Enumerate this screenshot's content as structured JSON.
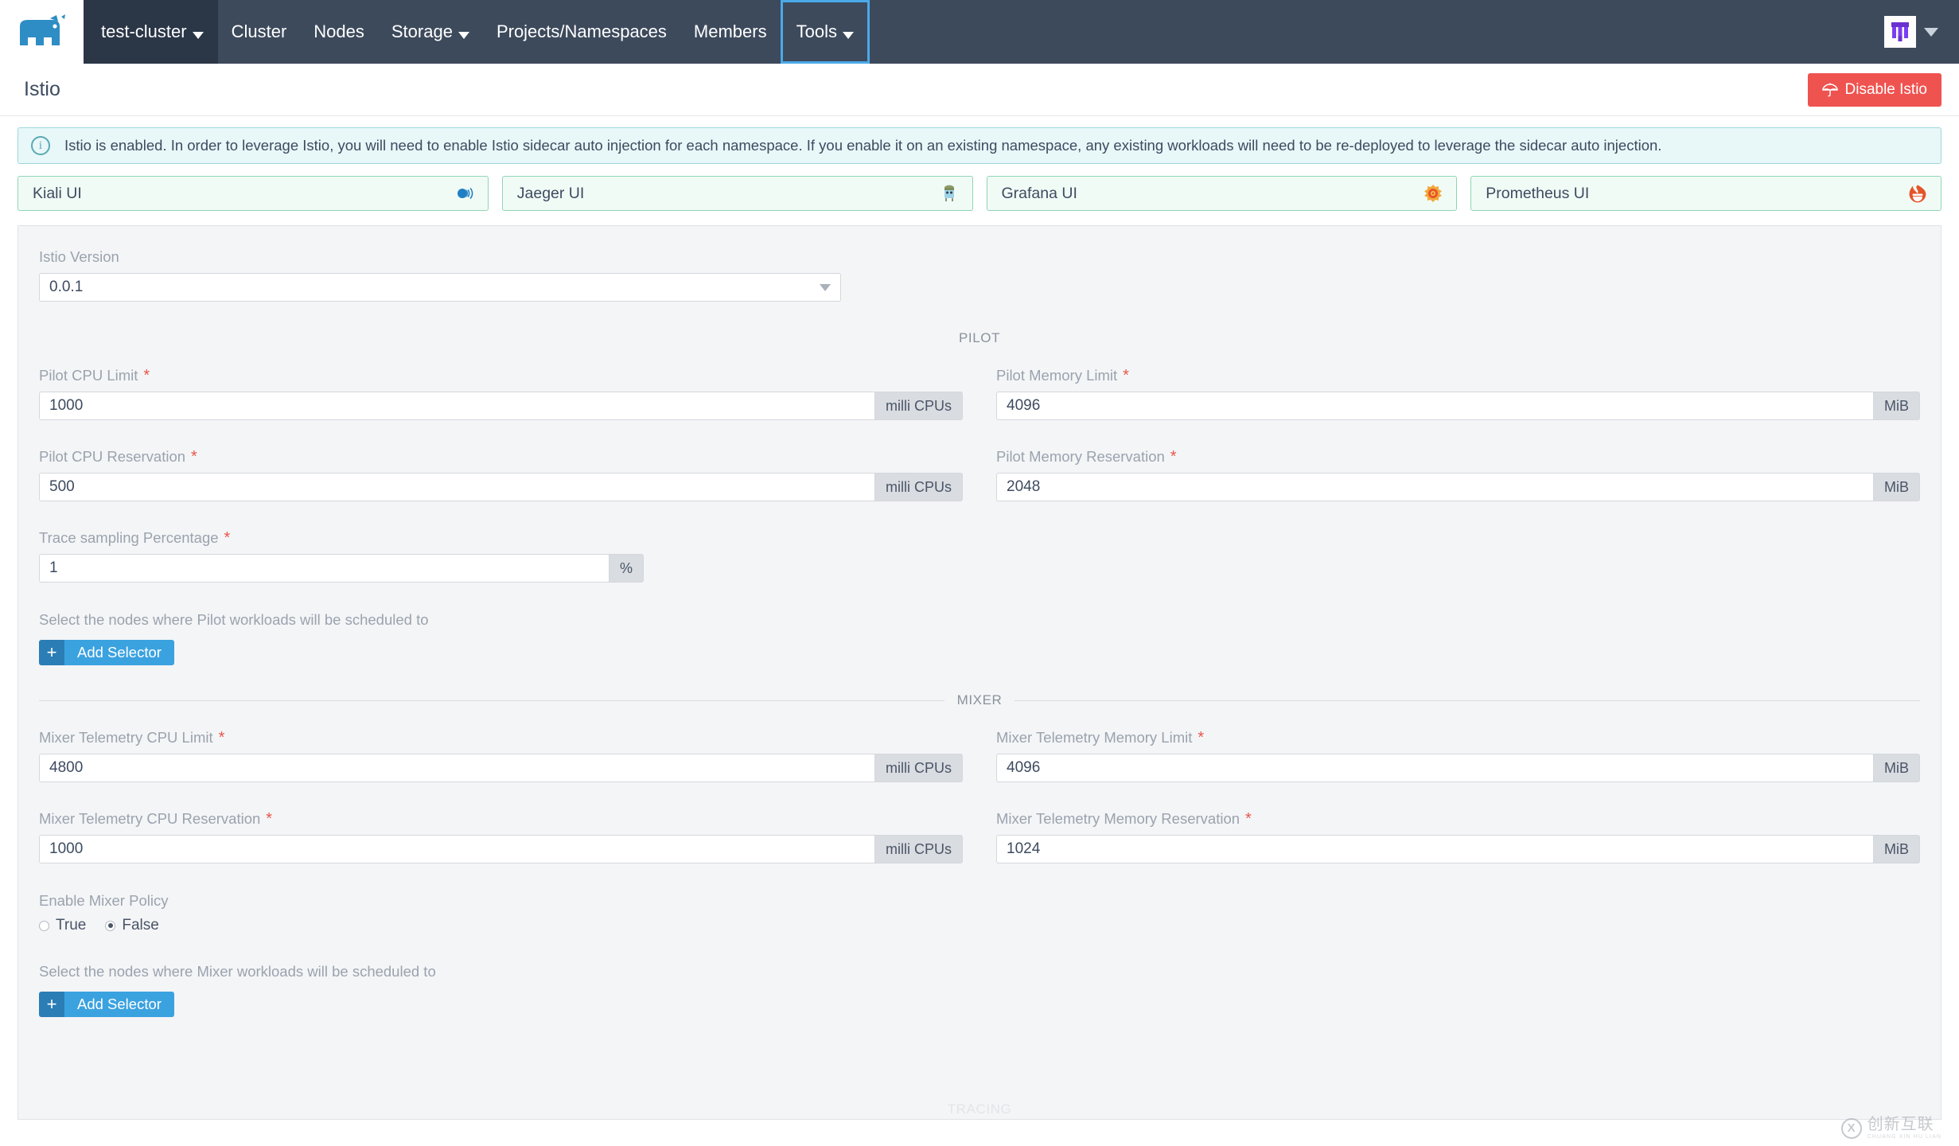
{
  "navbar": {
    "logo_icon": "rancher-cow-logo",
    "cluster_selector": {
      "label": "test-cluster",
      "icon": "chevron-down-icon"
    },
    "items": [
      {
        "label": "Cluster",
        "name": "nav-item-cluster",
        "has_caret": false,
        "focused": false
      },
      {
        "label": "Nodes",
        "name": "nav-item-nodes",
        "has_caret": false,
        "focused": false
      },
      {
        "label": "Storage",
        "name": "nav-item-storage",
        "has_caret": true,
        "focused": false
      },
      {
        "label": "Projects/Namespaces",
        "name": "nav-item-projects-namespaces",
        "has_caret": false,
        "focused": false
      },
      {
        "label": "Members",
        "name": "nav-item-members",
        "has_caret": false,
        "focused": false
      },
      {
        "label": "Tools",
        "name": "nav-item-tools",
        "has_caret": true,
        "focused": true
      }
    ],
    "user_menu": {
      "avatar_icon": "user-avatar-purple",
      "chevron_icon": "chevron-down-icon"
    },
    "background": "#3d4a5c",
    "active_background": "#2b3647",
    "focus_outline": "#4ba9e8"
  },
  "titlebar": {
    "title": "Istio",
    "disable_button": {
      "label": "Disable Istio",
      "icon": "umbrella-icon",
      "color": "#ef5350"
    }
  },
  "banner": {
    "icon": "info-circle-icon",
    "text": "Istio is enabled. In order to leverage Istio, you will need to enable Istio sidecar auto injection for each namespace. If you enable it on an existing namespace, any existing workloads will need to be re-deployed to leverage the sidecar auto injection.",
    "background": "#e8f7f8",
    "border": "#9fd7db"
  },
  "ui_cards": [
    {
      "label": "Kiali UI",
      "icon": "kiali-logo-icon",
      "name": "card-kiali-ui"
    },
    {
      "label": "Jaeger UI",
      "icon": "jaeger-logo-icon",
      "name": "card-jaeger-ui"
    },
    {
      "label": "Grafana UI",
      "icon": "grafana-logo-icon",
      "name": "card-grafana-ui"
    },
    {
      "label": "Prometheus UI",
      "icon": "prometheus-logo-icon",
      "name": "card-prometheus-ui"
    }
  ],
  "form": {
    "version": {
      "label": "Istio Version",
      "value": "0.0.1",
      "chevron_icon": "chevron-down-icon"
    },
    "pilot": {
      "section_label": "PILOT",
      "cpu_limit": {
        "label": "Pilot CPU Limit",
        "required": "*",
        "value": "1000",
        "unit": "milli CPUs"
      },
      "memory_limit": {
        "label": "Pilot Memory Limit",
        "required": "*",
        "value": "4096",
        "unit": "MiB"
      },
      "cpu_reservation": {
        "label": "Pilot CPU Reservation",
        "required": "*",
        "value": "500",
        "unit": "milli CPUs"
      },
      "memory_reservation": {
        "label": "Pilot Memory Reservation",
        "required": "*",
        "value": "2048",
        "unit": "MiB"
      },
      "trace_sampling": {
        "label": "Trace sampling Percentage",
        "required": "*",
        "value": "1",
        "unit": "%"
      },
      "node_selector_hint": "Select the nodes where Pilot workloads will be scheduled to",
      "add_selector": {
        "label": "Add Selector",
        "plus_icon": "plus-icon"
      }
    },
    "mixer": {
      "section_label": "MIXER",
      "cpu_limit": {
        "label": "Mixer Telemetry CPU Limit",
        "required": "*",
        "value": "4800",
        "unit": "milli CPUs"
      },
      "memory_limit": {
        "label": "Mixer Telemetry Memory Limit",
        "required": "*",
        "value": "4096",
        "unit": "MiB"
      },
      "cpu_reservation": {
        "label": "Mixer Telemetry CPU Reservation",
        "required": "*",
        "value": "1000",
        "unit": "milli CPUs"
      },
      "memory_reservation": {
        "label": "Mixer Telemetry Memory Reservation",
        "required": "*",
        "value": "1024",
        "unit": "MiB"
      },
      "enable_policy": {
        "label": "Enable Mixer Policy",
        "options": [
          {
            "label": "True",
            "selected": false
          },
          {
            "label": "False",
            "selected": true
          }
        ]
      },
      "node_selector_hint": "Select the nodes where Mixer workloads will be scheduled to",
      "add_selector": {
        "label": "Add Selector",
        "plus_icon": "plus-icon"
      }
    },
    "tracing": {
      "section_label": "TRACING"
    }
  },
  "watermark": {
    "main": "创新互联",
    "sub": "CHUANG XIN HU LIAN",
    "mark": "X"
  }
}
